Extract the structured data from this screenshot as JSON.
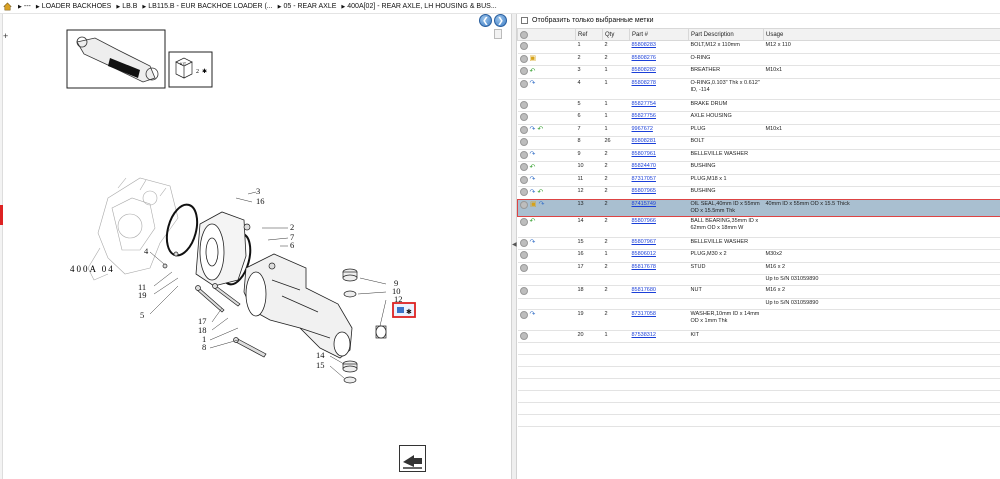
{
  "breadcrumb": {
    "items": [
      "---",
      "LOADER BACKHOES",
      "LB.B",
      "LB115.B - EUR BACKHOE LOADER (...",
      "05 - REAR AXLE",
      "400A[02] - REAR AXLE, LH HOUSING & BUS..."
    ]
  },
  "filter": {
    "label": "Отобразить только выбранные метки"
  },
  "table": {
    "headers": [
      "",
      "Ref",
      "Qty",
      "Part #",
      "Part Description",
      "Usage"
    ],
    "rows": [
      {
        "ref": "1",
        "qty": "2",
        "part": "85808283",
        "desc": "BOLT,M12 x 110mm",
        "usage": "M12 x 110",
        "icons": [],
        "kind": "row"
      },
      {
        "ref": "2",
        "qty": "2",
        "part": "85808276",
        "desc": "O-RING",
        "usage": "",
        "icons": [
          "box-icon"
        ],
        "kind": "row"
      },
      {
        "ref": "3",
        "qty": "1",
        "part": "85808282",
        "desc": "BREATHER",
        "usage": "M10x1",
        "icons": [
          "replace-icon"
        ],
        "kind": "row"
      },
      {
        "ref": "4",
        "qty": "1",
        "part": "85808278",
        "desc": "O-RING,0.103\" Thk x 0.612\" ID, -114",
        "usage": "",
        "icons": [
          "note-icon"
        ],
        "kind": "tall"
      },
      {
        "ref": "5",
        "qty": "1",
        "part": "85827754",
        "desc": "BRAKE DRUM",
        "usage": "",
        "icons": [],
        "kind": "row"
      },
      {
        "ref": "6",
        "qty": "1",
        "part": "85827756",
        "desc": "AXLE HOUSING",
        "usage": "",
        "icons": [],
        "kind": "row"
      },
      {
        "ref": "7",
        "qty": "1",
        "part": "9967672",
        "desc": "PLUG",
        "usage": "M10x1",
        "icons": [
          "note-icon",
          "replace-icon"
        ],
        "kind": "row"
      },
      {
        "ref": "8",
        "qty": "26",
        "part": "85808281",
        "desc": "BOLT",
        "usage": "",
        "icons": [],
        "kind": "row"
      },
      {
        "ref": "9",
        "qty": "2",
        "part": "85807961",
        "desc": "BELLEVILLE WASHER",
        "usage": "",
        "icons": [
          "note-icon"
        ],
        "kind": "row"
      },
      {
        "ref": "10",
        "qty": "2",
        "part": "85824470",
        "desc": "BUSHING",
        "usage": "",
        "icons": [
          "replace-icon"
        ],
        "kind": "row"
      },
      {
        "ref": "11",
        "qty": "2",
        "part": "87317057",
        "desc": "PLUG,M18 x 1",
        "usage": "",
        "icons": [
          "note-icon"
        ],
        "kind": "row"
      },
      {
        "ref": "12",
        "qty": "2",
        "part": "85807965",
        "desc": "BUSHING",
        "usage": "",
        "icons": [
          "note-icon",
          "replace-icon"
        ],
        "kind": "row"
      },
      {
        "ref": "13",
        "qty": "2",
        "part": "87415749",
        "desc": "OIL SEAL,40mm ID x 55mm OD x 15.5mm Thk",
        "usage": "40mm ID x 55mm OD x 15.5 Thick",
        "icons": [
          "box-icon",
          "note-icon"
        ],
        "kind": "sel"
      },
      {
        "ref": "14",
        "qty": "2",
        "part": "85807966",
        "desc": "BALL BEARING,35mm ID x 62mm OD x 18mm W",
        "usage": "",
        "icons": [
          "replace-icon"
        ],
        "kind": "tall"
      },
      {
        "ref": "15",
        "qty": "2",
        "part": "85807967",
        "desc": "BELLEVILLE WASHER",
        "usage": "",
        "icons": [
          "note-icon"
        ],
        "kind": "row"
      },
      {
        "ref": "16",
        "qty": "1",
        "part": "85806012",
        "desc": "PLUG,M30 x 2",
        "usage": "M30x2",
        "icons": [],
        "kind": "row"
      },
      {
        "ref": "17",
        "qty": "2",
        "part": "85817678",
        "desc": "STUD",
        "usage": "M16 x 2",
        "icons": [],
        "kind": "row"
      },
      {
        "ref": "",
        "qty": "",
        "part": "",
        "desc": "",
        "usage": "Up to S/N 031059890",
        "icons": [],
        "kind": "sub"
      },
      {
        "ref": "18",
        "qty": "2",
        "part": "85817680",
        "desc": "NUT",
        "usage": "M16 x 2",
        "icons": [],
        "kind": "row"
      },
      {
        "ref": "",
        "qty": "",
        "part": "",
        "desc": "",
        "usage": "Up to S/N 031059890",
        "icons": [],
        "kind": "sub"
      },
      {
        "ref": "19",
        "qty": "2",
        "part": "87317058",
        "desc": "WASHER,10mm ID x 14mm OD x 1mm Thk",
        "usage": "",
        "icons": [
          "note-icon"
        ],
        "kind": "tall"
      },
      {
        "ref": "20",
        "qty": "1",
        "part": "87538312",
        "desc": "KIT",
        "usage": "",
        "icons": [],
        "kind": "row"
      }
    ]
  },
  "diagram": {
    "callouts": [
      "3",
      "16",
      "2",
      "7",
      "6",
      "4",
      "11",
      "19",
      "5",
      "17",
      "18",
      "1",
      "8",
      "9",
      "10",
      "12",
      "14",
      "15"
    ],
    "kit_label": "KIT",
    "kit_ref": "2",
    "section_label": "400A 04"
  },
  "colors": {
    "selected_row": "#a9bfd0",
    "highlight_red": "#d22222",
    "link": "#1a3fd8"
  }
}
